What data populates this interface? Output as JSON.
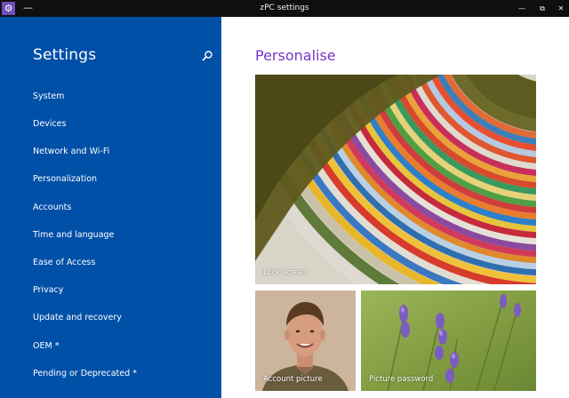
{
  "titlebar": {
    "menu_glyph": "—",
    "title": "zPC settings",
    "minimize": "—",
    "restore": "⧉",
    "close": "✕",
    "app_icon": "gear-icon"
  },
  "sidebar": {
    "title": "Settings",
    "search_icon": "search-icon",
    "items": [
      {
        "label": "System"
      },
      {
        "label": "Devices"
      },
      {
        "label": "Network and Wi-Fi"
      },
      {
        "label": "Personalization"
      },
      {
        "label": "Accounts"
      },
      {
        "label": "Time and language"
      },
      {
        "label": "Ease of Access"
      },
      {
        "label": "Privacy"
      },
      {
        "label": "Update and recovery"
      },
      {
        "label": "OEM *"
      },
      {
        "label": "Pending or Deprecated *"
      }
    ]
  },
  "main": {
    "heading": "Personalise",
    "tiles": [
      {
        "label": "Lock screen"
      },
      {
        "label": "Account picture"
      },
      {
        "label": "Picture password"
      }
    ]
  },
  "colors": {
    "sidebar_bg": "#0050a8",
    "heading_accent": "#7a35c8",
    "titlebar_bg": "#0f0f0f"
  }
}
